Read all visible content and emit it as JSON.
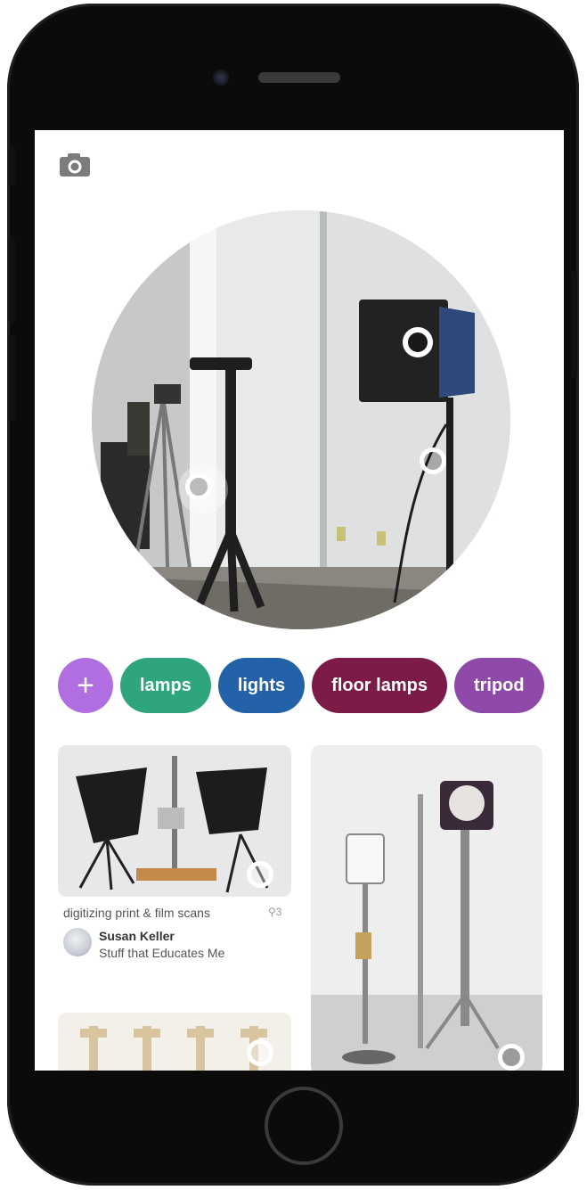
{
  "chips": [
    {
      "label": "+",
      "color": "#b06ee0"
    },
    {
      "label": "lamps",
      "color": "#2fa57e"
    },
    {
      "label": "lights",
      "color": "#2361a8"
    },
    {
      "label": "floor lamps",
      "color": "#7c1b47"
    },
    {
      "label": "tripod",
      "color": "#8e49a9"
    }
  ],
  "pin": {
    "title": "digitizing print & film scans",
    "count": "3",
    "user": "Susan Keller",
    "board": "Stuff that Educates Me"
  },
  "icons": {
    "camera": "camera-icon",
    "pin": "pin-icon",
    "lens_dot": "lens-dot-icon"
  }
}
